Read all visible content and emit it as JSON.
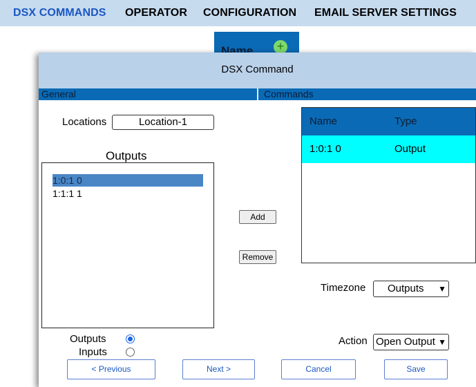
{
  "nav": {
    "items": [
      "DSX COMMANDS",
      "OPERATOR",
      "CONFIGURATION",
      "EMAIL SERVER SETTINGS"
    ],
    "active_color": "#1a57c2"
  },
  "background_card": {
    "label": "Name",
    "add_icon": "plus-circle-icon"
  },
  "dialog": {
    "title": "DSX Command",
    "tabs": [
      "General",
      "Commands"
    ],
    "locations_label": "Locations",
    "locations_value": "Location-1",
    "outputs_title": "Outputs",
    "outputs_list": [
      "1:0:1 0",
      "1:1:1 1"
    ],
    "selected_output": "1:0:1 0",
    "add_label": "Add",
    "remove_label": "Remove",
    "commands_table": {
      "headers": [
        "Name",
        "Type"
      ],
      "rows": [
        [
          "1:0:1 0",
          "Output"
        ]
      ]
    },
    "timezone_label": "Timezone",
    "timezone_value": "Outputs",
    "action_label": "Action",
    "action_value": "Open Output",
    "radio_outputs_label": "Outputs",
    "radio_inputs_label": "Inputs",
    "radio_selected": "Outputs",
    "buttons": {
      "previous": "< Previous",
      "next": "Next >",
      "cancel": "Cancel",
      "save": "Save"
    }
  },
  "colors": {
    "header_bg": "#c7dbef",
    "tab_bg": "#0a6ab5",
    "row_highlight": "#00ffff",
    "selected_item": "#4a86c5"
  }
}
